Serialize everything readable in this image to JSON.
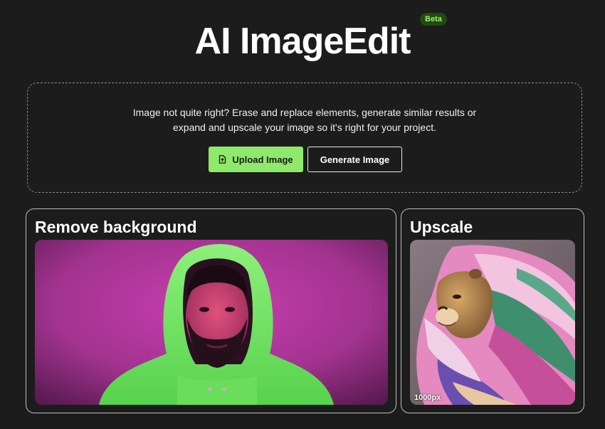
{
  "header": {
    "title": "AI ImageEdit",
    "badge": "Beta"
  },
  "upload": {
    "description_line1": "Image not quite right? Erase and replace elements, generate similar results or",
    "description_line2": "expand and upscale your image so it's right for your project.",
    "upload_button": "Upload Image",
    "generate_button": "Generate Image",
    "upload_icon": "file-upload-icon"
  },
  "cards": {
    "remove_background": {
      "title": "Remove background"
    },
    "upscale": {
      "title": "Upscale",
      "size_label": "1000px"
    }
  },
  "colors": {
    "background": "#1c1c1c",
    "accent": "#8fe96a",
    "badge_bg": "#1f4a12",
    "badge_text": "#9ef06c"
  }
}
